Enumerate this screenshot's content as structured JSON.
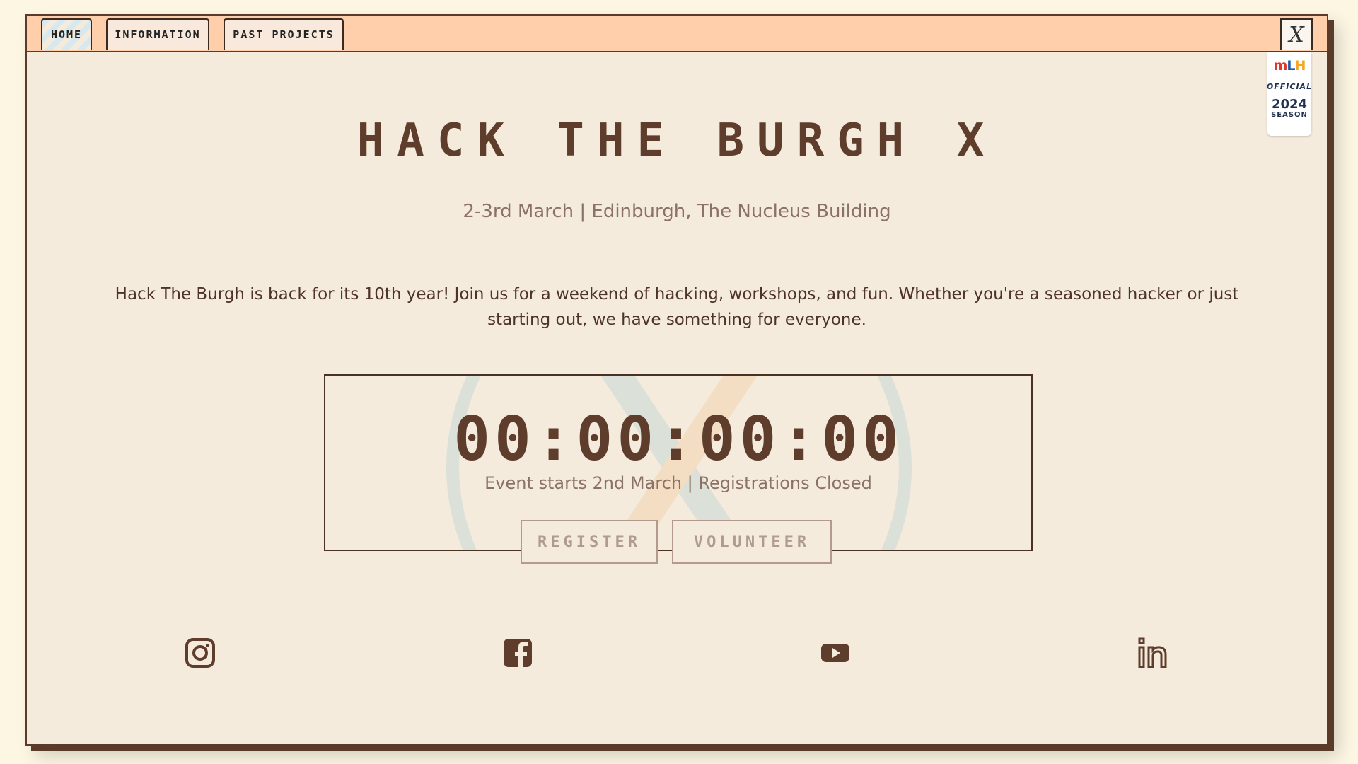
{
  "tabs": [
    {
      "label": "HOME"
    },
    {
      "label": "INFORMATION"
    },
    {
      "label": "PAST PROJECTS"
    }
  ],
  "close_label": "X",
  "mlh_badge": {
    "logo_m": "m",
    "logo_l": "L",
    "logo_h": "H",
    "official": "OFFICIAL",
    "year": "2024",
    "season": "SEASON"
  },
  "hero": {
    "title": "HACK THE BURGH X",
    "subtitle": "2-3rd March | Edinburgh, The Nucleus Building",
    "intro": "Hack The Burgh is back for its 10th year! Join us for a weekend of hacking, workshops, and fun. Whether you're a seasoned hacker or just starting out, we have something for everyone."
  },
  "countdown": {
    "timer": "00:00:00:00",
    "status": "Event starts 2nd March | Registrations Closed"
  },
  "buttons": {
    "register": "REGISTER",
    "volunteer": "VOLUNTEER"
  },
  "social": [
    "instagram-icon",
    "facebook-icon",
    "youtube-icon",
    "linkedin-icon"
  ],
  "colors": {
    "brown": "#5e3d2c",
    "peach": "#ffcfab",
    "cream": "#f4ebdd"
  }
}
